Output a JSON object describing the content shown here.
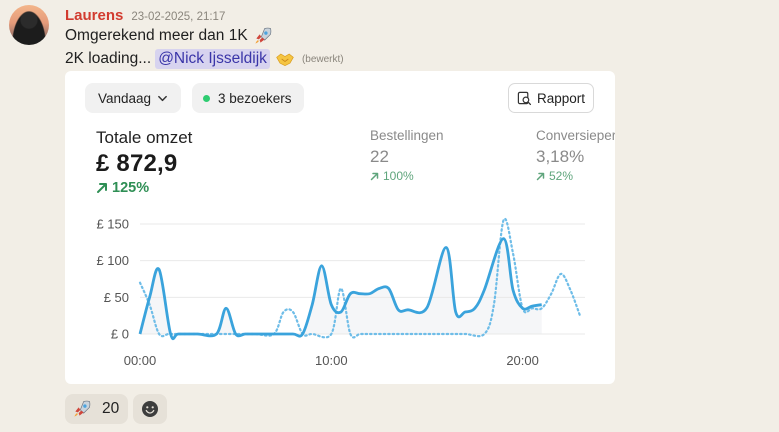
{
  "message": {
    "author": "Laurens",
    "timestamp": "23-02-2025, 21:17",
    "line1": "Omgerekend meer dan 1K",
    "line2_prefix": "2K loading...",
    "mention": "@Nick Ijsseldijk",
    "edited": "(bewerkt)"
  },
  "card": {
    "date_filter": "Vandaag",
    "visitors": "3 bezoekers",
    "report_button": "Rapport",
    "main_kpi": {
      "label": "Totale omzet",
      "value": "£ 872,9",
      "change": "125%"
    },
    "kpis": [
      {
        "label": "Bestellingen",
        "value": "22",
        "change": "100%"
      },
      {
        "label": "Conversieper",
        "value": "3,18%",
        "change": "52%"
      }
    ]
  },
  "chart_data": {
    "type": "line",
    "y_ticks": [
      "£ 150",
      "£ 100",
      "£ 50",
      "£ 0"
    ],
    "x_ticks": [
      "00:00",
      "10:00",
      "20:00"
    ],
    "ylim": [
      0,
      150
    ],
    "xlim_hours": [
      0,
      23
    ],
    "series": [
      {
        "style": "solid",
        "color": "#3aa3dc",
        "x": [
          0,
          0.5,
          1,
          1.6,
          2,
          3,
          4,
          4.5,
          5,
          5.5,
          6,
          7,
          8,
          8.5,
          9,
          9.5,
          10,
          10.5,
          11,
          11.5,
          12,
          12.5,
          13,
          13.5,
          14,
          15,
          16,
          16.5,
          17,
          17.5,
          18,
          19,
          19.5,
          20,
          20.5,
          21
        ],
        "y": [
          0,
          50,
          88,
          0,
          0,
          0,
          0,
          35,
          0,
          0,
          0,
          0,
          0,
          0,
          40,
          93,
          40,
          30,
          55,
          55,
          55,
          62,
          62,
          33,
          33,
          36,
          118,
          30,
          30,
          35,
          60,
          130,
          60,
          35,
          38,
          40
        ]
      },
      {
        "style": "dotted",
        "color": "#6fbde8",
        "x": [
          0,
          0.5,
          1,
          1.5,
          2,
          3,
          4,
          5,
          6,
          7,
          7.5,
          8,
          8.5,
          9,
          10,
          10.5,
          11,
          11.5,
          12,
          13,
          14,
          15,
          16,
          17,
          18,
          18.5,
          19,
          19.5,
          20,
          20.5,
          21,
          21.5,
          22,
          22.5,
          23
        ],
        "y": [
          70,
          40,
          0,
          0,
          0,
          0,
          0,
          0,
          0,
          0,
          30,
          30,
          0,
          0,
          0,
          62,
          0,
          0,
          0,
          0,
          0,
          0,
          0,
          0,
          0,
          40,
          155,
          110,
          35,
          35,
          35,
          55,
          82,
          60,
          25
        ]
      }
    ],
    "grid": true
  },
  "reactions": [
    {
      "emoji": "rocket",
      "count": "20"
    }
  ],
  "icons": {
    "avatar": "user-avatar",
    "rocket": "rocket-icon",
    "handshake": "handshake-icon",
    "add_reaction": "add-reaction-icon"
  }
}
